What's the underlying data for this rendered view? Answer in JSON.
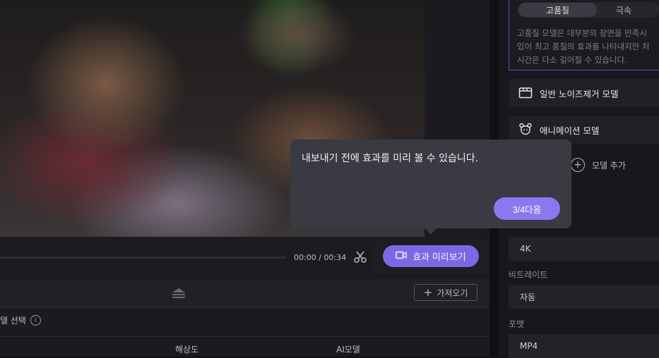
{
  "player": {
    "time": "00:00 / 00:34",
    "preview_label": "효과 미리보기"
  },
  "tooltip": {
    "text": "내보내기 전에 효과를 미리 볼 수 있습니다.",
    "next_label": "3/4다음"
  },
  "list": {
    "import_label": "가져오기",
    "select_label": "델 선택",
    "info_glyph": "i",
    "columns": [
      "해상도",
      "AI모델"
    ]
  },
  "right_panel": {
    "quality_tabs": [
      {
        "label": "고품질",
        "selected": true
      },
      {
        "label": "극속",
        "selected": false
      }
    ],
    "quality_desc": [
      "고품질 모델은 대부분의 장면을 만족시",
      "있어 최고 품질의 효과를 나타내지만 처",
      "시간은 다소 길어질 수 있습니다."
    ],
    "models": [
      {
        "label": "일반 노이즈제거 모델",
        "icon": "clapperboard-icon"
      },
      {
        "label": "애니메이션 모델",
        "icon": "bear-icon"
      }
    ],
    "add_model_label": "모델 추가",
    "resolution_value": "4K",
    "bitrate_label": "비트레이트",
    "bitrate_value": "자동",
    "format_label": "포맷",
    "format_value": "MP4"
  },
  "colors": {
    "accent": "#7a69e4",
    "tooltip_button": "#8a78f0",
    "tooltip_bg": "#3a3a42"
  }
}
